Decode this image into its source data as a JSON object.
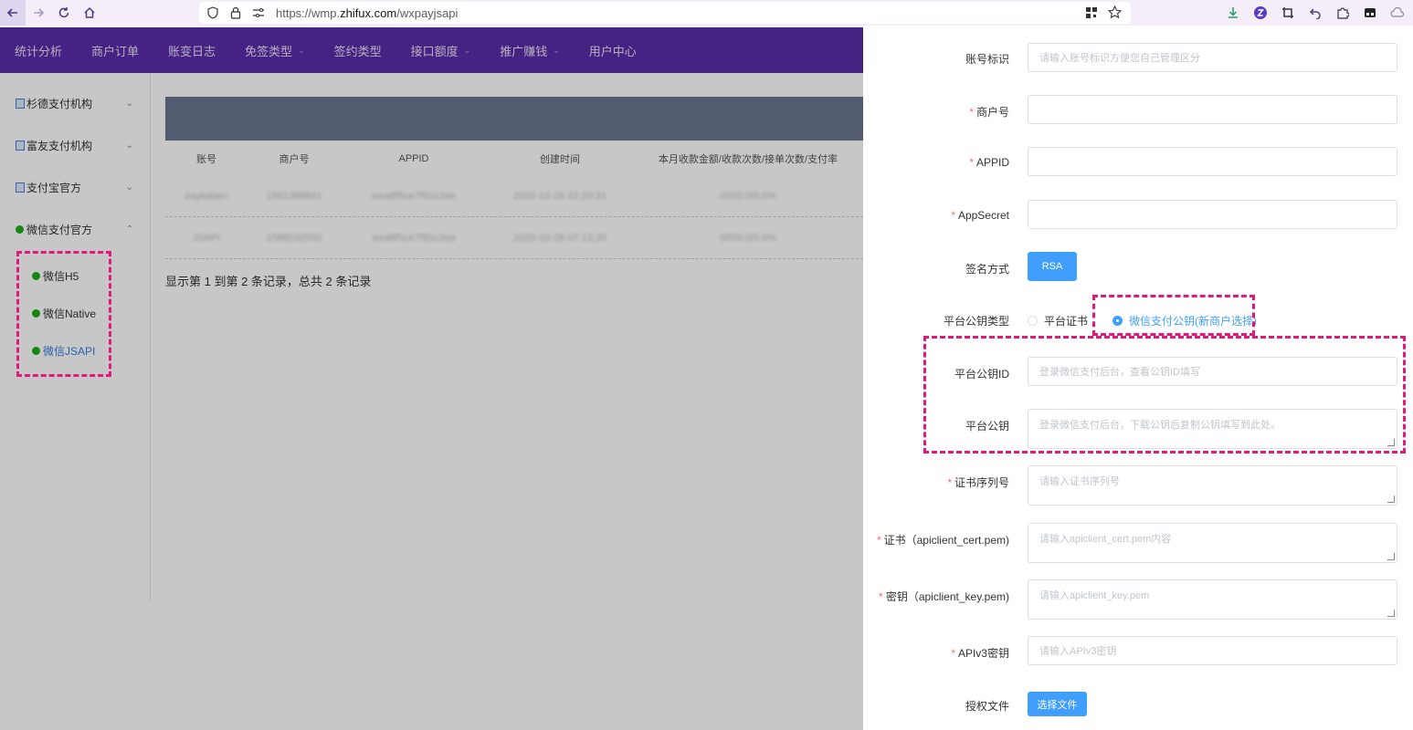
{
  "browser": {
    "url_prefix": "https://wmp.",
    "url_domain": "zhifux.com",
    "url_path": "/wxpayjsapi"
  },
  "topnav": [
    {
      "label": "统计分析"
    },
    {
      "label": "商户订单"
    },
    {
      "label": "账变日志"
    },
    {
      "label": "免签类型",
      "caret": "⌄"
    },
    {
      "label": "签约类型"
    },
    {
      "label": "接口额度",
      "caret": "⌄"
    },
    {
      "label": "推广赚钱",
      "caret": "⌄"
    },
    {
      "label": "用户中心"
    }
  ],
  "sidebar": {
    "groups": [
      {
        "label": "杉德支付机构",
        "chev": "⌄"
      },
      {
        "label": "富友支付机构",
        "chev": "⌄"
      },
      {
        "label": "支付宝官方",
        "chev": "⌄"
      },
      {
        "label": "微信支付官方",
        "chev": "⌃"
      }
    ],
    "subs": [
      {
        "label": "微信H5"
      },
      {
        "label": "微信Native"
      },
      {
        "label": "微信JSAPI"
      }
    ]
  },
  "table": {
    "headers": [
      "账号",
      "商户号",
      "APPID",
      "创建时间",
      "本月收款金额/收款次数/接单次数/支付率"
    ],
    "rows": [
      [
        "zaykaben",
        "1581388841",
        "wxa8f5ce7f91c2ee",
        "2020-10-26 22:20:31",
        "0/0/0.0/0.0%"
      ],
      [
        "JSAPI",
        "1588032550",
        "wxa8f5ce7f91c2ee",
        "2020-10-26 07:13:20",
        "0/0/0.0/0.0%"
      ]
    ],
    "summary": "显示第 1 到第 2 条记录，总共 2 条记录"
  },
  "form": {
    "account_label": "账号标识",
    "account_placeholder": "请输入账号标识方便您自己管理区分",
    "merchant_label": "商户号",
    "appid_label": "APPID",
    "appsecret_label": "AppSecret",
    "sign_label": "签名方式",
    "sign_button": "RSA",
    "pubkey_type_label": "平台公钥类型",
    "pubkey_type_options": [
      "平台证书",
      "微信支付公钥(新商户选择)"
    ],
    "pubkey_id_label": "平台公钥ID",
    "pubkey_id_placeholder": "登录微信支付后台，查看公钥ID填写",
    "pubkey_label": "平台公钥",
    "pubkey_placeholder": "登录微信支付后台，下载公钥后复制公钥填写到此处。",
    "serial_label": "证书序列号",
    "serial_placeholder": "请输入证书序列号",
    "cert_label": "证书（apiclient_cert.pem)",
    "cert_placeholder": "请输入apiclient_cert.pem内容",
    "key_label": "密钥（apiclient_key.pem)",
    "key_placeholder": "请输入apiclient_key.pem",
    "apiv3_label": "APIv3密钥",
    "apiv3_placeholder": "请输入APIv3密钥",
    "auth_label": "授权文件",
    "auth_button": "选择文件",
    "required_mark": "*"
  },
  "colors": {
    "nav_purple": "#5a2ca8",
    "primary_blue": "#409eff",
    "highlight_pink": "#e0197a",
    "wechat_green": "#1aad19"
  }
}
